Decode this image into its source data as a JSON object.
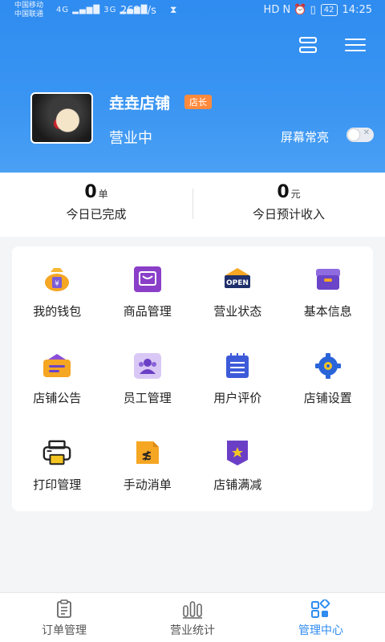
{
  "status_bar": {
    "carrier1": "中国移动",
    "carrier2": "中国联通",
    "signal": "4G ▂▄▆█ 3G ▂▄▆█",
    "speed": "269B/s",
    "time": "14:25",
    "battery": "42",
    "indicators": "HD N ⏰ ▯"
  },
  "shop": {
    "name": "垚垚店铺",
    "role_badge": "店长",
    "status": "营业中",
    "screen_on_label": "屏幕常亮",
    "screen_on": false
  },
  "stats": [
    {
      "value": "0",
      "unit": "单",
      "label": "今日已完成"
    },
    {
      "value": "0",
      "unit": "元",
      "label": "今日预计收入"
    }
  ],
  "menu": [
    {
      "label": "我的钱包",
      "icon": "wallet-icon"
    },
    {
      "label": "商品管理",
      "icon": "product-icon"
    },
    {
      "label": "营业状态",
      "icon": "open-sign-icon",
      "sign_text": "OPEN"
    },
    {
      "label": "基本信息",
      "icon": "info-box-icon"
    },
    {
      "label": "店铺公告",
      "icon": "notice-icon"
    },
    {
      "label": "员工管理",
      "icon": "staff-icon"
    },
    {
      "label": "用户评价",
      "icon": "review-icon"
    },
    {
      "label": "店铺设置",
      "icon": "settings-gear-icon"
    },
    {
      "label": "打印管理",
      "icon": "printer-icon"
    },
    {
      "label": "手动消单",
      "icon": "cancel-order-icon"
    },
    {
      "label": "店铺满减",
      "icon": "discount-badge-icon"
    }
  ],
  "tabs": [
    {
      "label": "订单管理",
      "icon": "order-list-icon",
      "active": false
    },
    {
      "label": "营业统计",
      "icon": "bar-stats-icon",
      "active": false
    },
    {
      "label": "管理中心",
      "icon": "management-grid-icon",
      "active": true
    }
  ],
  "colors": {
    "primary": "#2f8cf0",
    "badge": "#ff8a3d",
    "wallet": "#f5a623",
    "purple": "#8a4fd8",
    "navy": "#1f2f6b"
  }
}
